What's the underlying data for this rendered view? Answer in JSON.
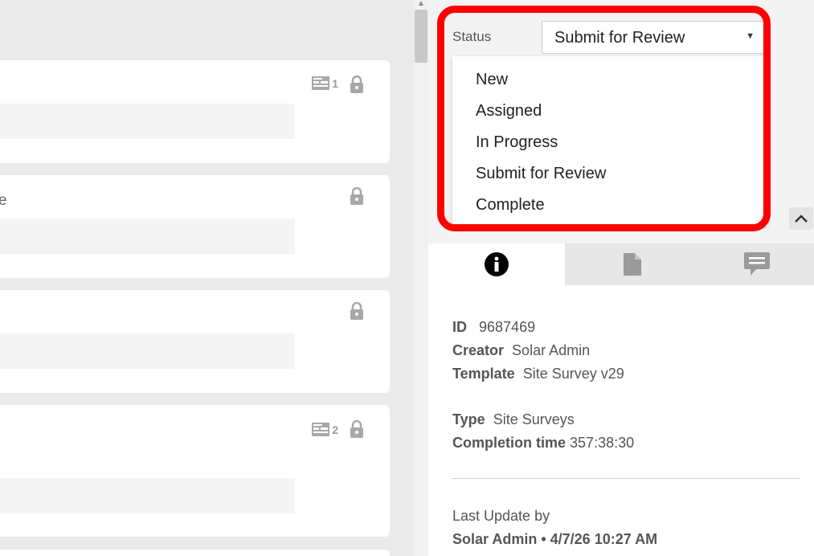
{
  "cards": [
    {
      "attachment_count": "1",
      "partial_text": ""
    },
    {
      "attachment_count": "",
      "partial_text": "e"
    },
    {
      "attachment_count": "",
      "partial_text": ""
    },
    {
      "attachment_count": "2",
      "partial_text": ""
    }
  ],
  "status": {
    "label": "Status",
    "selected": "Submit for Review",
    "options": [
      "New",
      "Assigned",
      "In Progress",
      "Submit for Review",
      "Complete"
    ]
  },
  "tabs": [
    {
      "icon": "info-icon",
      "active": true
    },
    {
      "icon": "document-icon",
      "active": false
    },
    {
      "icon": "comment-icon",
      "active": false
    }
  ],
  "details": {
    "id_label": "ID",
    "id_value": "9687469",
    "creator_label": "Creator",
    "creator_value": "Solar Admin",
    "template_label": "Template",
    "template_value": "Site Survey v29",
    "type_label": "Type",
    "type_value": "Site Surveys",
    "completion_label": "Completion time",
    "completion_value": "357:38:30",
    "last_update_label": "Last Update by",
    "last_update_value": "Solar Admin • 4/7/26 10:27 AM"
  },
  "colors": {
    "highlight": "#ff0000",
    "tab_bar": "#e7e7e7",
    "background": "#ebeaea"
  }
}
